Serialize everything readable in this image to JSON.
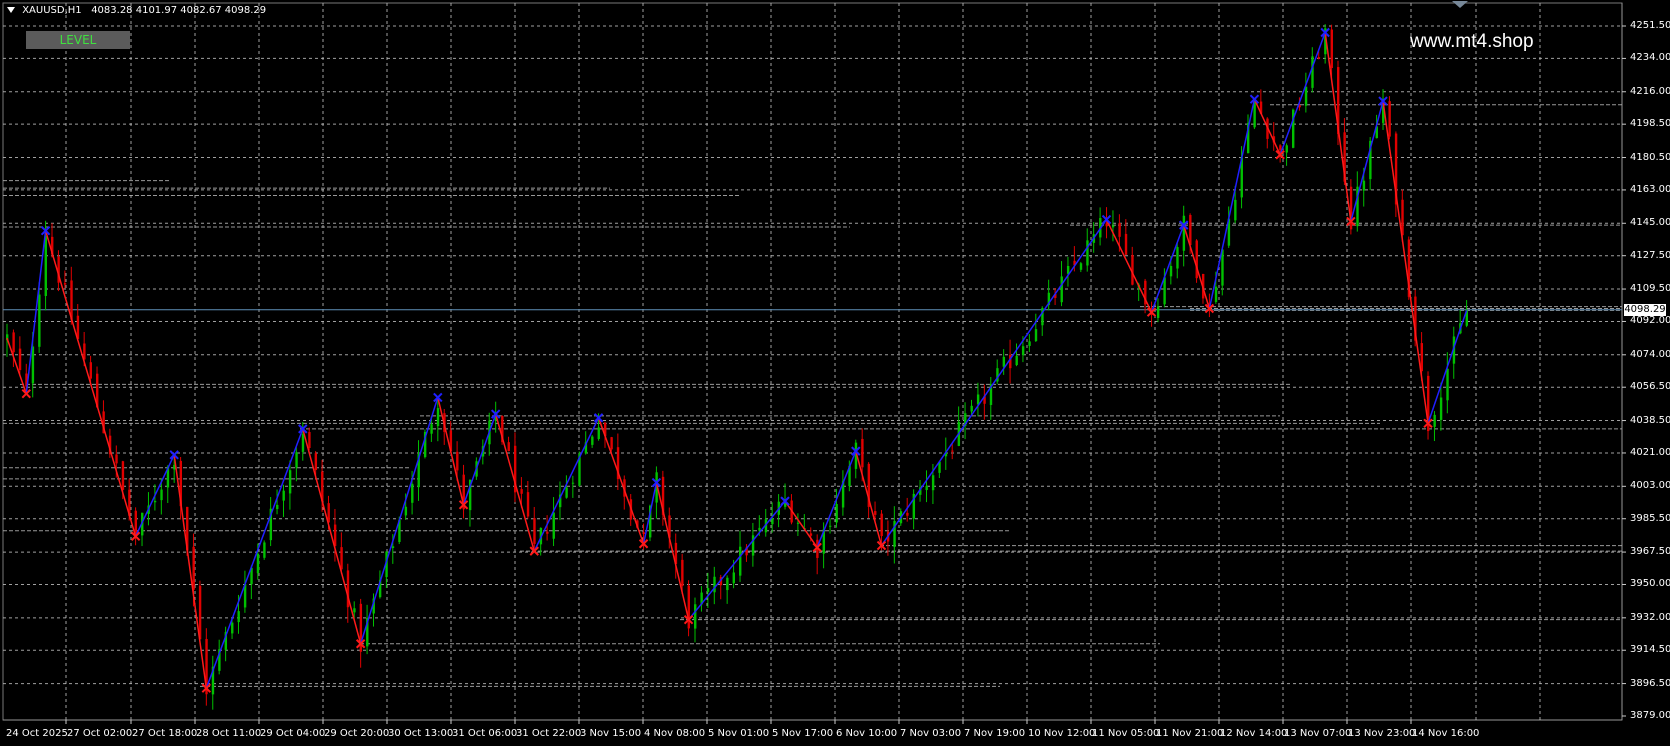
{
  "window": {
    "symbol": "XAUUSD,H1",
    "ohlc": "4083.28 4101.97 4082.67 4098.29",
    "level_button": "LEVEL",
    "watermark": "www.mt4.shop",
    "current_price": "4098.29"
  },
  "colors": {
    "background": "#000000",
    "grid": "#c8c8c8",
    "bull_candle": "#00c000",
    "bear_candle": "#e00000",
    "zigzag_up": "#2020ff",
    "zigzag_down": "#ff1a1a",
    "price_line": "#5f8fb8",
    "level_lines": "#b4b4b4"
  },
  "chart_data": {
    "type": "candlestick",
    "symbol": "XAUUSD",
    "timeframe": "H1",
    "y_axis": {
      "min": 3879,
      "max": 4260,
      "tick_labels": [
        "4251.50",
        "4234.00",
        "4216.00",
        "4198.50",
        "4180.50",
        "4163.00",
        "4145.00",
        "4127.50",
        "4109.50",
        "4092.00",
        "4074.00",
        "4056.50",
        "4038.50",
        "4021.00",
        "4003.00",
        "3985.50",
        "3967.50",
        "3950.00",
        "3932.00",
        "3914.50",
        "3896.50",
        "3879.00"
      ]
    },
    "x_axis": {
      "tick_labels": [
        "24 Oct 2025",
        "27 Oct 02:00",
        "27 Oct 18:00",
        "28 Oct 11:00",
        "29 Oct 04:00",
        "29 Oct 20:00",
        "30 Oct 13:00",
        "31 Oct 06:00",
        "31 Oct 22:00",
        "3 Nov 15:00",
        "4 Nov 08:00",
        "5 Nov 01:00",
        "5 Nov 17:00",
        "6 Nov 10:00",
        "7 Nov 03:00",
        "7 Nov 19:00",
        "10 Nov 12:00",
        "11 Nov 05:00",
        "11 Nov 21:00",
        "12 Nov 14:00",
        "13 Nov 07:00",
        "13 Nov 23:00",
        "14 Nov 16:00"
      ]
    },
    "zigzag_swings": [
      {
        "bar": 0,
        "price": 4083,
        "type": "start"
      },
      {
        "bar": 3,
        "price": 4053,
        "type": "low"
      },
      {
        "bar": 6,
        "price": 4141,
        "type": "high"
      },
      {
        "bar": 20,
        "price": 3976,
        "type": "low"
      },
      {
        "bar": 26,
        "price": 4020,
        "type": "high"
      },
      {
        "bar": 31,
        "price": 3894,
        "type": "low"
      },
      {
        "bar": 46,
        "price": 4034,
        "type": "high"
      },
      {
        "bar": 55,
        "price": 3918,
        "type": "low"
      },
      {
        "bar": 67,
        "price": 4051,
        "type": "high"
      },
      {
        "bar": 71,
        "price": 3993,
        "type": "low"
      },
      {
        "bar": 76,
        "price": 4042,
        "type": "high"
      },
      {
        "bar": 82,
        "price": 3968,
        "type": "low"
      },
      {
        "bar": 92,
        "price": 4040,
        "type": "high"
      },
      {
        "bar": 99,
        "price": 3972,
        "type": "low"
      },
      {
        "bar": 101,
        "price": 4005,
        "type": "high"
      },
      {
        "bar": 106,
        "price": 3931,
        "type": "low"
      },
      {
        "bar": 121,
        "price": 3995,
        "type": "high"
      },
      {
        "bar": 126,
        "price": 3970,
        "type": "low"
      },
      {
        "bar": 132,
        "price": 4022,
        "type": "high"
      },
      {
        "bar": 136,
        "price": 3971,
        "type": "low"
      },
      {
        "bar": 171,
        "price": 4147,
        "type": "high"
      },
      {
        "bar": 178,
        "price": 4097,
        "type": "low"
      },
      {
        "bar": 183,
        "price": 4144,
        "type": "high"
      },
      {
        "bar": 187,
        "price": 4099,
        "type": "low"
      },
      {
        "bar": 194,
        "price": 4212,
        "type": "high"
      },
      {
        "bar": 198,
        "price": 4182,
        "type": "low"
      },
      {
        "bar": 205,
        "price": 4248,
        "type": "high"
      },
      {
        "bar": 209,
        "price": 4146,
        "type": "low"
      },
      {
        "bar": 214,
        "price": 4211,
        "type": "high"
      },
      {
        "bar": 221,
        "price": 4037,
        "type": "low"
      },
      {
        "bar": 227,
        "price": 4098,
        "type": "end"
      }
    ],
    "level_lines": [
      4168,
      4164,
      4160,
      4143,
      4058,
      4041,
      4037,
      4034,
      4013,
      4007,
      3979,
      3971,
      3968,
      3931,
      3918,
      3895,
      4209,
      4144,
      4100,
      4099,
      4098
    ]
  }
}
